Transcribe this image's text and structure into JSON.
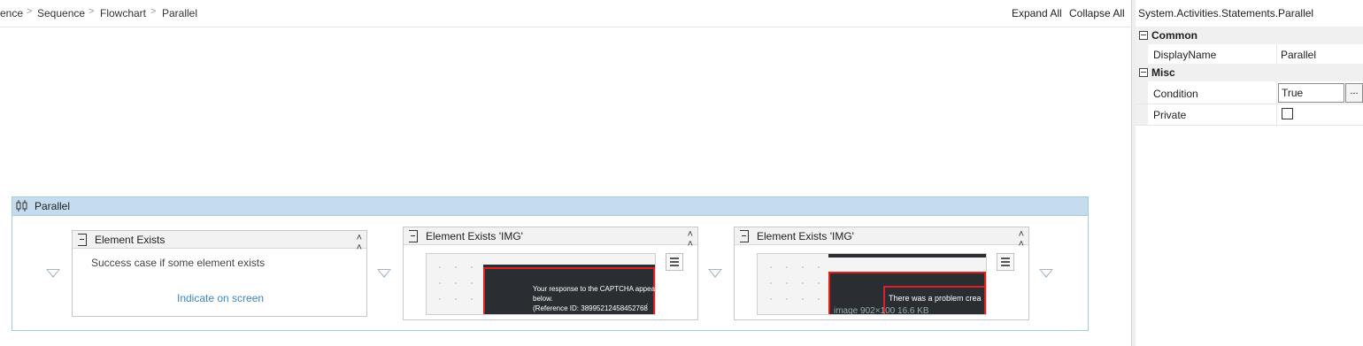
{
  "breadcrumb": {
    "items": [
      "ence",
      "Sequence",
      "Flowchart",
      "Parallel"
    ]
  },
  "header": {
    "expand_all": "Expand All",
    "collapse_all": "Collapse All"
  },
  "parallel": {
    "title": "Parallel",
    "activities": [
      {
        "title": "Element Exists",
        "description": "Success case if some element exists",
        "indicate_link": "Indicate on screen"
      },
      {
        "title": "Element Exists 'IMG'",
        "thumb_text": [
          "Your response to the CAPTCHA appears",
          "below.",
          "(Reference ID: 38995212458452768́"
        ]
      },
      {
        "title": "Element Exists 'IMG'",
        "thumb_text": [
          "There was a problem crea"
        ],
        "thumb_caption": "image  902×100 16.6 KB"
      }
    ]
  },
  "properties": {
    "title": "System.Activities.Statements.Parallel",
    "categories": [
      {
        "name": "Common",
        "rows": [
          {
            "name": "DisplayName",
            "value": "Parallel"
          }
        ]
      },
      {
        "name": "Misc",
        "rows": [
          {
            "name": "Condition",
            "value": "True",
            "button": "..."
          },
          {
            "name": "Private",
            "checked": false
          }
        ]
      }
    ]
  },
  "colors": {
    "parallel_header": "#c5dcef",
    "link": "#3c86c4",
    "highlight_red": "#e02020"
  },
  "icons": [
    "parallel-icon",
    "activity-icon",
    "collapse-chevrons-icon",
    "drop-arrow-icon",
    "menu-icon",
    "expand-collapse-box-icon"
  ]
}
